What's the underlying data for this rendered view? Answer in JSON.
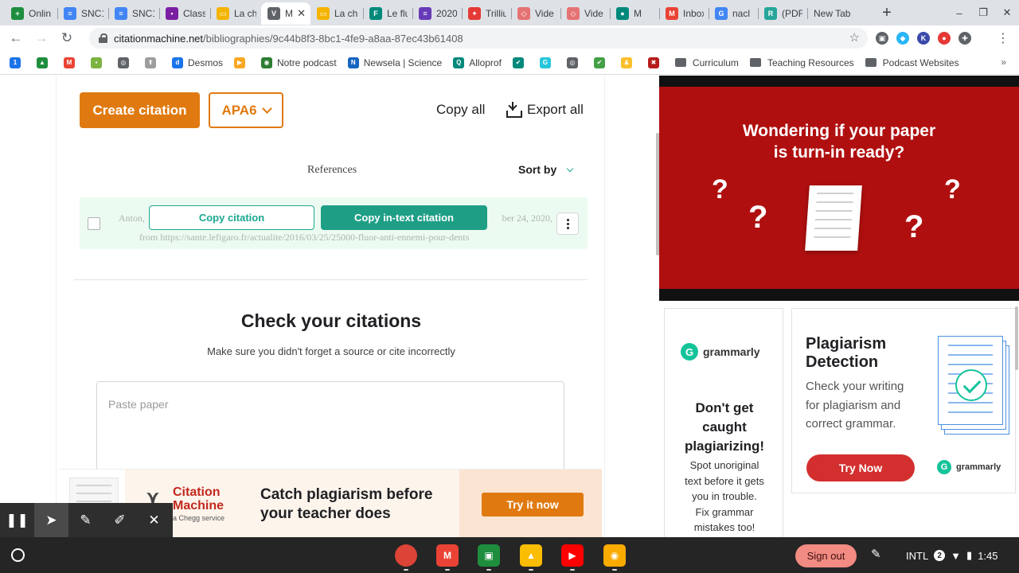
{
  "browser": {
    "tabs": [
      {
        "label": "Onlin",
        "favicon_color": "#1e8e3e",
        "favicon_glyph": "+"
      },
      {
        "label": "SNC1",
        "favicon_color": "#4285f4",
        "favicon_glyph": "≡"
      },
      {
        "label": "SNC1",
        "favicon_color": "#4285f4",
        "favicon_glyph": "≡"
      },
      {
        "label": "Class",
        "favicon_color": "#7b1fa2",
        "favicon_glyph": "▪"
      },
      {
        "label": "La ch",
        "favicon_color": "#f4b400",
        "favicon_glyph": "▭"
      },
      {
        "label": "M",
        "favicon_color": "#5f6368",
        "favicon_glyph": "V",
        "active": true
      },
      {
        "label": "La ch",
        "favicon_color": "#f4b400",
        "favicon_glyph": "▭"
      },
      {
        "label": "Le flu",
        "favicon_color": "#00897b",
        "favicon_glyph": "F"
      },
      {
        "label": "2020",
        "favicon_color": "#673ab7",
        "favicon_glyph": "≡"
      },
      {
        "label": "Trilliu",
        "favicon_color": "#e53935",
        "favicon_glyph": "✦"
      },
      {
        "label": "Vide",
        "favicon_color": "#e57373",
        "favicon_glyph": "◇"
      },
      {
        "label": "Vide",
        "favicon_color": "#e57373",
        "favicon_glyph": "◇"
      },
      {
        "label": "M",
        "favicon_color": "#00897b",
        "favicon_glyph": "●"
      },
      {
        "label": "Inbox",
        "favicon_color": "#ea4335",
        "favicon_glyph": "M"
      },
      {
        "label": "nacl",
        "favicon_color": "#4285f4",
        "favicon_glyph": "G"
      },
      {
        "label": "(PDF",
        "favicon_color": "#26a69a",
        "favicon_glyph": "R"
      },
      {
        "label": "New Tab",
        "favicon_color": "",
        "favicon_glyph": ""
      }
    ],
    "tab_close_glyph": "✕",
    "new_tab_glyph": "+",
    "url_host": "citationmachine.net",
    "url_path": "/bibliographies/9c44b8f3-8bc1-4fe9-a8aa-87ec43b61408",
    "extensions": [
      {
        "name": "shield-extension-icon",
        "color": "#5f6368",
        "glyph": "▣"
      },
      {
        "name": "diamond-extension-icon",
        "color": "#29b6f6",
        "glyph": "◆"
      },
      {
        "name": "k-extension-icon",
        "color": "#3949ab",
        "glyph": "K"
      },
      {
        "name": "record-extension-icon",
        "color": "#e53935",
        "glyph": "●"
      },
      {
        "name": "puzzle-extension-icon",
        "color": "#5f6368",
        "glyph": "✚"
      },
      {
        "name": "profile-extension-icon",
        "color": "#5f6368",
        "glyph": "⋯"
      }
    ],
    "bookmarks": [
      {
        "label": "",
        "color": "#1a73e8",
        "glyph": "1"
      },
      {
        "label": "",
        "color": "#1e8e3e",
        "glyph": "▲"
      },
      {
        "label": "",
        "color": "#ea4335",
        "glyph": "M"
      },
      {
        "label": "",
        "color": "#7cb342",
        "glyph": "▪"
      },
      {
        "label": "",
        "color": "#5f6368",
        "glyph": "◎"
      },
      {
        "label": "",
        "color": "#9e9e9e",
        "glyph": "⬆"
      },
      {
        "label": "Desmos",
        "color": "#1a73e8",
        "glyph": "d"
      },
      {
        "label": "",
        "color": "#f9a825",
        "glyph": "▶"
      },
      {
        "label": "Notre podcast",
        "color": "#2e7d32",
        "glyph": "◉"
      },
      {
        "label": "Newsela | Science",
        "color": "#1565c0",
        "glyph": "N"
      },
      {
        "label": "Alloprof",
        "color": "#00897b",
        "glyph": "Q"
      },
      {
        "label": "",
        "color": "#00897b",
        "glyph": "✔"
      },
      {
        "label": "",
        "color": "#26c6da",
        "glyph": "G"
      },
      {
        "label": "",
        "color": "#5f6368",
        "glyph": "◎"
      },
      {
        "label": "",
        "color": "#43a047",
        "glyph": "✔"
      },
      {
        "label": "",
        "color": "#fbc02d",
        "glyph": "♟"
      },
      {
        "label": "",
        "color": "#b71c1c",
        "glyph": "✖"
      }
    ],
    "bookmark_folders": [
      "Curriculum",
      "Teaching Resources",
      "Podcast Websites"
    ]
  },
  "citation_page": {
    "create_button": "Create citation",
    "style_select": "APA6",
    "copy_all": "Copy all",
    "export_all": "Export all",
    "references_label": "References",
    "sort_by": "Sort by",
    "citation": {
      "line1_start": "Anton,",
      "line1_end": "ber 24, 2020,",
      "line2": "from https://sante.lefigaro.fr/actualite/2016/03/25/25000-fluor-anti-ennemi-pour-dents",
      "copy_citation": "Copy citation",
      "copy_intext": "Copy in-text citation"
    },
    "check_title": "Check your citations",
    "check_subtitle": "Make sure you didn't forget a source or cite incorrectly",
    "paste_placeholder": "Paste paper"
  },
  "bottom_ad": {
    "brand_line1": "Citation",
    "brand_line2": "Machine",
    "brand_sub": "a Chegg service",
    "headline_line1": "Catch plagiarism before",
    "headline_line2": "your teacher does",
    "cta": "Try it now"
  },
  "red_ad": {
    "title_line1": "Wondering if your paper",
    "title_line2": "is turn-in ready?",
    "mark": "?"
  },
  "grammarly_ad_left": {
    "brand": "grammarly",
    "headline_line1": "Don't get",
    "headline_line2": "caught",
    "headline_line3": "plagiarizing!",
    "body_line1": "Spot unoriginal",
    "body_line2": "text before it gets",
    "body_line3": "you in trouble.",
    "body_line4": "Fix grammar",
    "body_line5": "mistakes too!"
  },
  "grammarly_ad_right": {
    "headline_line1": "Plagiarism",
    "headline_line2": "Detection",
    "body_line1": "Check your writing",
    "body_line2": "for plagiarism and",
    "body_line3": "correct grammar.",
    "cta": "Try Now",
    "brand": "grammarly"
  },
  "shelf": {
    "apps": [
      {
        "name": "chrome-app-icon",
        "color": "#db4437"
      },
      {
        "name": "gmail-app-icon",
        "color": "#ea4335"
      },
      {
        "name": "classroom-app-icon",
        "color": "#1e8e3e"
      },
      {
        "name": "drive-app-icon",
        "color": "#fbbc04"
      },
      {
        "name": "youtube-app-icon",
        "color": "#ff0000"
      },
      {
        "name": "keep-app-icon",
        "color": "#f9ab00"
      }
    ],
    "sign_out": "Sign out",
    "input_method": "INTL",
    "notification_count": "2",
    "time": "1:45"
  },
  "colors": {
    "brand_orange": "#e07a10",
    "citation_teal": "#1f9e86",
    "grammarly_green": "#15c39a",
    "ad_red": "#b00f0f"
  }
}
